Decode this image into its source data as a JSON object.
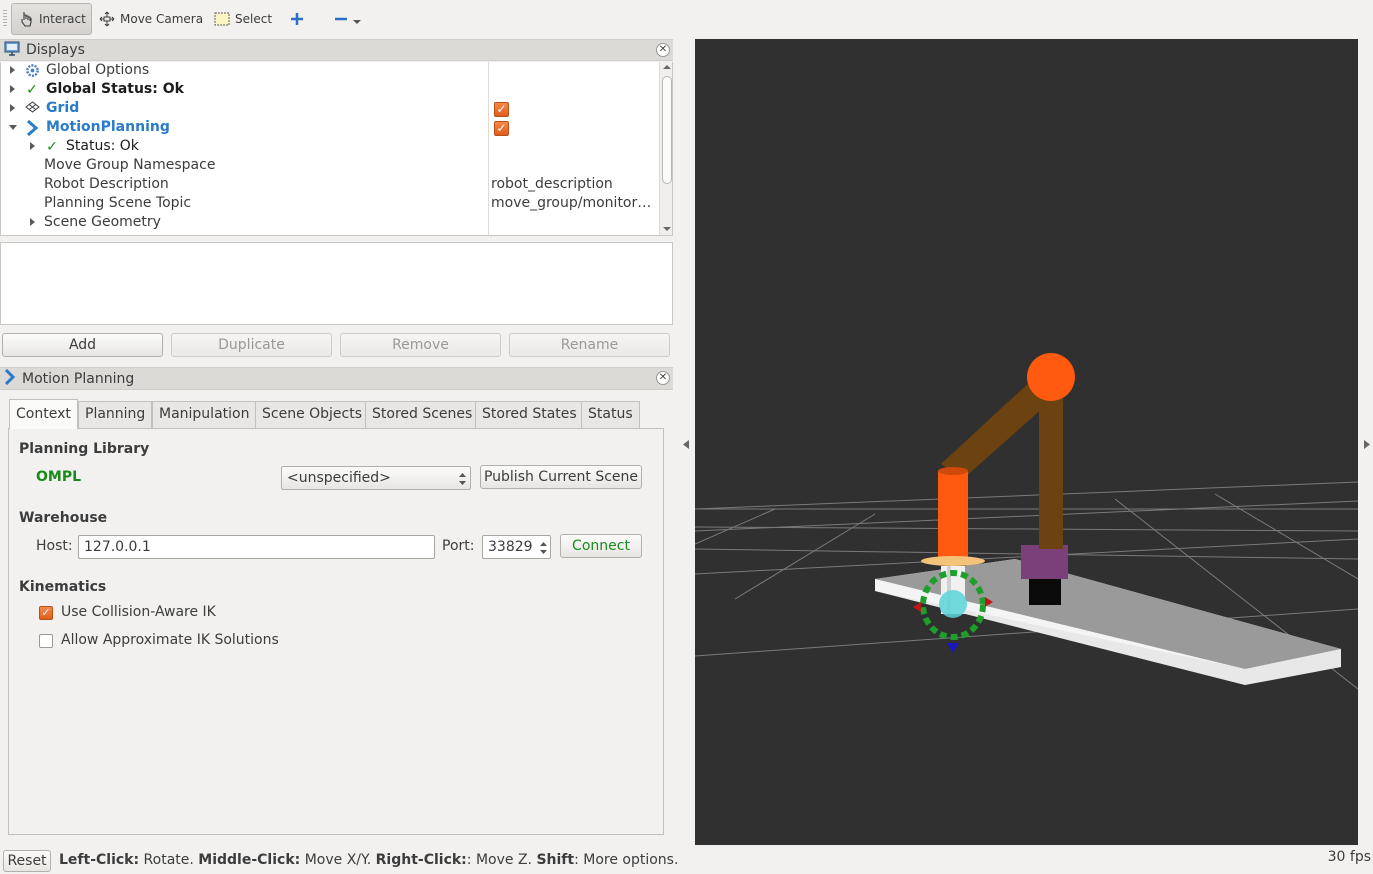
{
  "toolbar": {
    "interact_label": "Interact",
    "move_camera_label": "Move Camera",
    "select_label": "Select"
  },
  "displays_panel": {
    "title": "Displays",
    "tree": [
      {
        "label": "Global Options"
      },
      {
        "label": "Global Status: Ok"
      },
      {
        "label": "Grid",
        "checked": true
      },
      {
        "label": "MotionPlanning",
        "checked": true
      },
      {
        "label": "Status: Ok"
      },
      {
        "label": "Move Group Namespace",
        "value": ""
      },
      {
        "label": "Robot Description",
        "value": "robot_description"
      },
      {
        "label": "Planning Scene Topic",
        "value": "move_group/monitor…"
      },
      {
        "label": "Scene Geometry"
      }
    ],
    "buttons": {
      "add": "Add",
      "duplicate": "Duplicate",
      "remove": "Remove",
      "rename": "Rename"
    }
  },
  "motion_planning": {
    "title": "Motion Planning",
    "tabs": [
      "Context",
      "Planning",
      "Manipulation",
      "Scene Objects",
      "Stored Scenes",
      "Stored States",
      "Status"
    ],
    "active_tab": "Context",
    "planning_library": {
      "heading": "Planning Library",
      "library_name": "OMPL",
      "planner_select": "<unspecified>",
      "publish_button": "Publish Current Scene"
    },
    "warehouse": {
      "heading": "Warehouse",
      "host_label": "Host:",
      "host_value": "127.0.0.1",
      "port_label": "Port:",
      "port_value": "33829",
      "connect_button": "Connect"
    },
    "kinematics": {
      "heading": "Kinematics",
      "collision_aware_ik": {
        "label": "Use Collision-Aware IK",
        "checked": true
      },
      "approximate_ik": {
        "label": "Allow Approximate IK Solutions",
        "checked": false
      }
    }
  },
  "status_bar": {
    "reset_button": "Reset",
    "hint_left_click": "Left-Click:",
    "hint_rotate": " Rotate. ",
    "hint_middle_click": "Middle-Click:",
    "hint_move_xy": " Move X/Y. ",
    "hint_right_click": "Right-Click:",
    "hint_move_z": ": Move Z. ",
    "hint_shift": "Shift",
    "hint_more": ": More options.",
    "fps": "30 fps"
  },
  "colors": {
    "accent_orange": "#e86a2a",
    "link_blue": "#2a7bc9",
    "status_green": "#1a8a1a",
    "viewport_bg": "#303030"
  }
}
